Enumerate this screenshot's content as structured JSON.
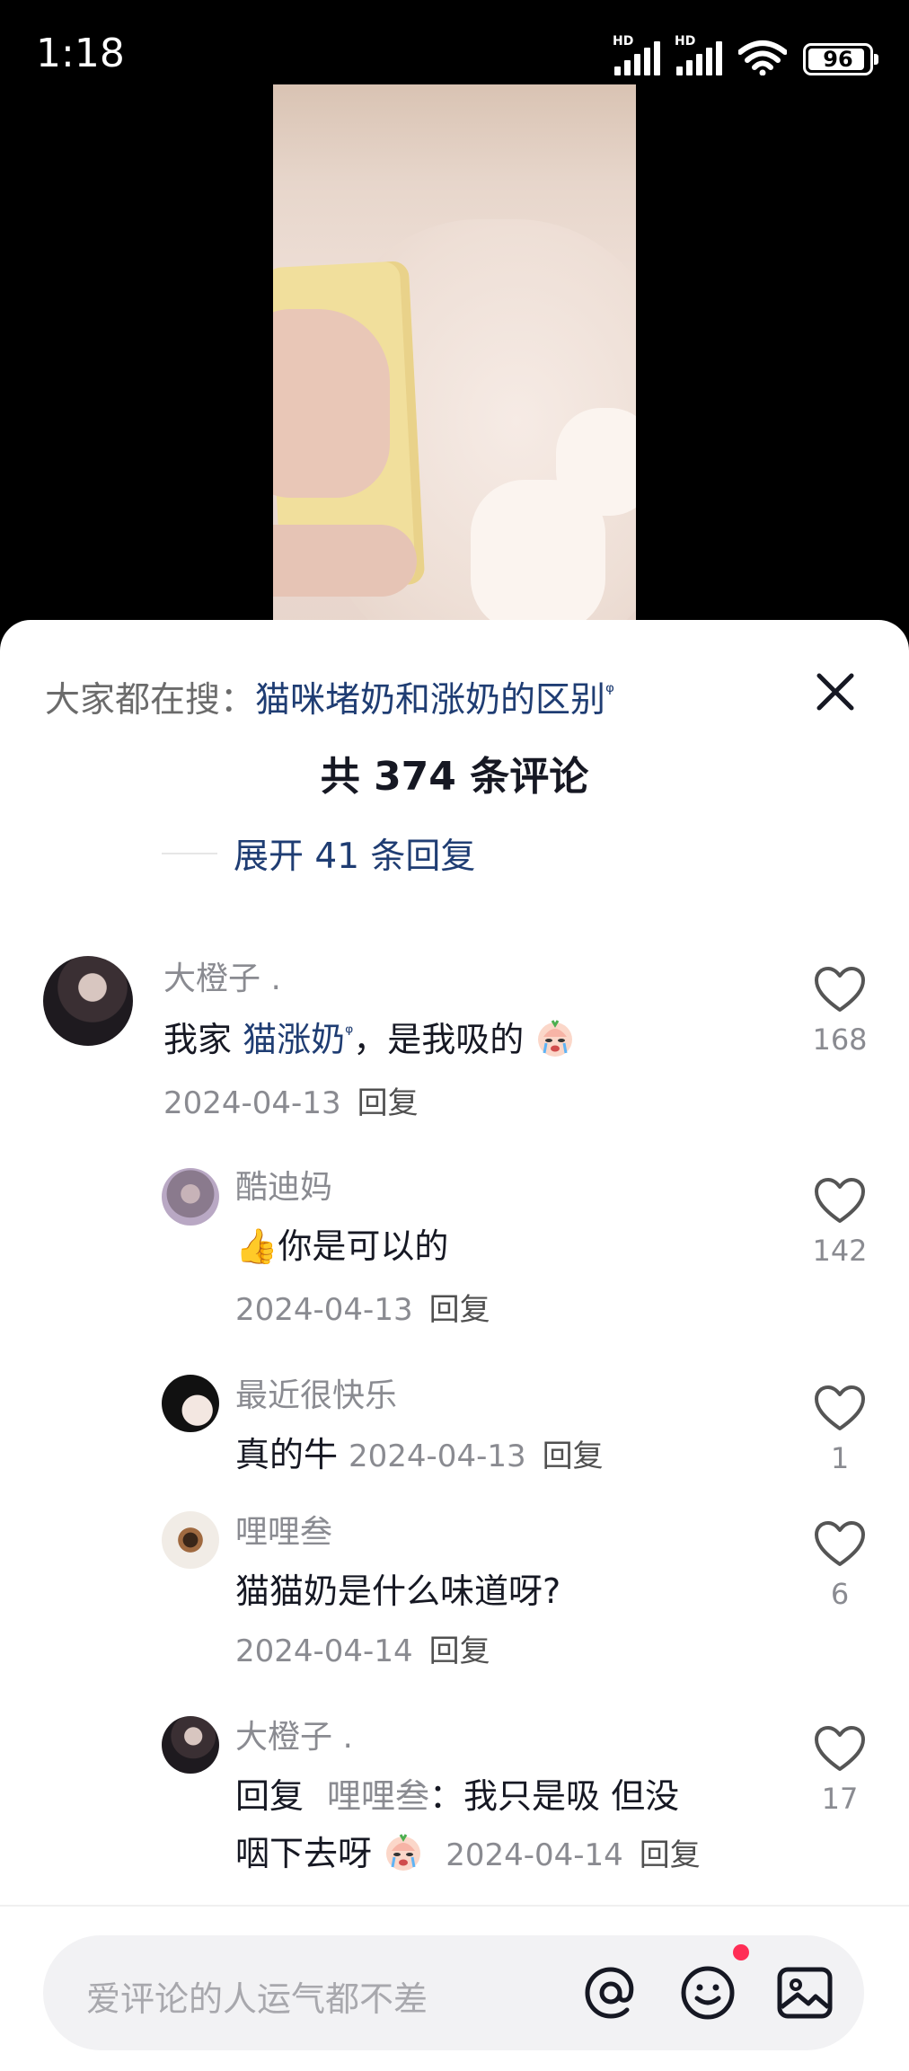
{
  "status_bar": {
    "time": "1:18",
    "battery": "96",
    "signal_label": "HD"
  },
  "search_hint": {
    "label": "大家都在搜：",
    "keyword": "猫咪堵奶和涨奶的区别"
  },
  "comments_header": {
    "title": "共 374 条评论"
  },
  "expand_replies": "展开 41 条回复",
  "comments": [
    {
      "user": "大橙子 .",
      "text_prefix": "我家 ",
      "link": "猫涨奶",
      "text_suffix": "，是我吸的",
      "date": "2024-04-13",
      "reply": "回复",
      "likes": "168"
    },
    {
      "user": "酷迪妈",
      "text": "你是可以的",
      "date": "2024-04-13",
      "reply": "回复",
      "likes": "142"
    },
    {
      "user": "最近很快乐",
      "text": "真的牛",
      "date": "2024-04-13",
      "reply": "回复",
      "likes": "1"
    },
    {
      "user": "哩哩叁",
      "text": "猫猫奶是什么味道呀?",
      "date": "2024-04-14",
      "reply": "回复",
      "likes": "6"
    },
    {
      "user": "大橙子 .",
      "reply_prefix": "回复",
      "reply_to": "哩哩叁",
      "text_line1": "：我只是吸 但没",
      "text_line2": "咽下去呀",
      "date": "2024-04-14",
      "reply": "回复",
      "likes": "17"
    }
  ],
  "input": {
    "placeholder": "爱评论的人运气都不差"
  },
  "icons": [
    "search-suggestion-icon",
    "close-icon",
    "heart-icon",
    "thumbs-up-emoji",
    "crying-emoji",
    "at-icon",
    "emoji-icon",
    "image-icon"
  ],
  "colors": {
    "link": "#1f3d73",
    "muted": "#8a8b91",
    "notify": "#ff2d55"
  }
}
